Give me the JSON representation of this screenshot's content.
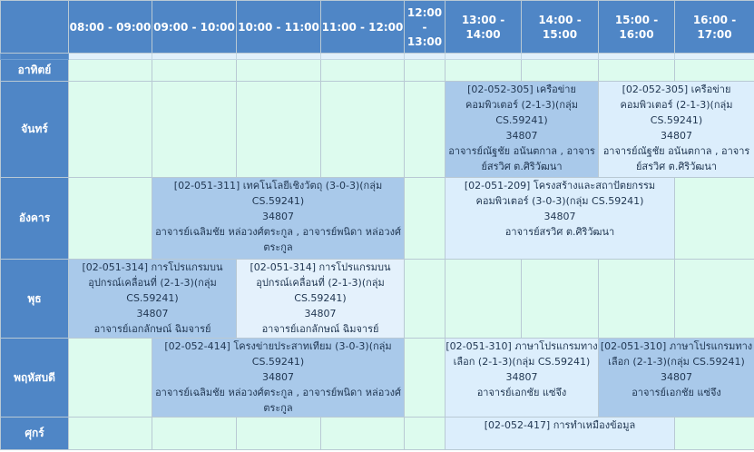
{
  "times": [
    "08:00 - 09:00",
    "09:00 - 10:00",
    "10:00 - 11:00",
    "11:00 - 12:00",
    "12:00 - 13:00",
    "13:00 - 14:00",
    "14:00 - 15:00",
    "15:00 - 16:00",
    "16:00 - 17:00"
  ],
  "days": {
    "sun": "อาทิตย์",
    "mon": "จันทร์",
    "tue": "อังคาร",
    "wed": "พุธ",
    "thu": "พฤหัสบดี",
    "fri": "ศุกร์"
  },
  "courses": {
    "mon_1": {
      "title": "[02-052-305] เครือข่ายคอมพิวเตอร์ (2-1-3)(กลุ่ม CS.59241)",
      "code": "34807",
      "teacher": "อาจารย์ณัฐชัย อนันตกาล , อาจารย์สรวิศ ต.ศิริวัฒนา"
    },
    "mon_2": {
      "title": "[02-052-305] เครือข่ายคอมพิวเตอร์ (2-1-3)(กลุ่ม CS.59241)",
      "code": "34807",
      "teacher": "อาจารย์ณัฐชัย อนันตกาล , อาจารย์สรวิศ ต.ศิริวัฒนา"
    },
    "tue_1": {
      "title": "[02-051-311] เทคโนโลยีเชิงวัตถุ (3-0-3)(กลุ่ม CS.59241)",
      "code": "34807",
      "teacher": "อาจารย์เฉลิมชัย หล่อวงศ์ตระกูล , อาจารย์พนิดา หล่อวงศ์ตระกูล"
    },
    "tue_2": {
      "title": "[02-051-209] โครงสร้างและสถาปัตยกรรมคอมพิวเตอร์ (3-0-3)(กลุ่ม CS.59241)",
      "code": "34807",
      "teacher": "อาจารย์สรวิศ ต.ศิริวัฒนา"
    },
    "wed_1": {
      "title": "[02-051-314] การโปรแกรมบนอุปกรณ์เคลื่อนที่ (2-1-3)(กลุ่ม CS.59241)",
      "code": "34807",
      "teacher": "อาจารย์เอกลักษณ์ ฉิมจารย์"
    },
    "wed_2": {
      "title": "[02-051-314] การโปรแกรมบนอุปกรณ์เคลื่อนที่ (2-1-3)(กลุ่ม CS.59241)",
      "code": "34807",
      "teacher": "อาจารย์เอกลักษณ์ ฉิมจารย์"
    },
    "thu_1": {
      "title": "[02-052-414] โครงข่ายประสาทเทียม (3-0-3)(กลุ่ม CS.59241)",
      "code": "34807",
      "teacher": "อาจารย์เฉลิมชัย หล่อวงศ์ตระกูล , อาจารย์พนิดา หล่อวงศ์ตระกูล"
    },
    "thu_2": {
      "title": "[02-051-310] ภาษาโปรแกรมทางเลือก (2-1-3)(กลุ่ม CS.59241)",
      "code": "34807",
      "teacher": "อาจารย์เอกชัย แซ่จึง"
    },
    "thu_3": {
      "title": "[02-051-310] ภาษาโปรแกรมทางเลือก (2-1-3)(กลุ่ม CS.59241)",
      "code": "34807",
      "teacher": "อาจารย์เอกชัย แซ่จึง"
    },
    "fri_1": {
      "title": "[02-052-417] การทำเหมืองข้อมูล"
    }
  }
}
